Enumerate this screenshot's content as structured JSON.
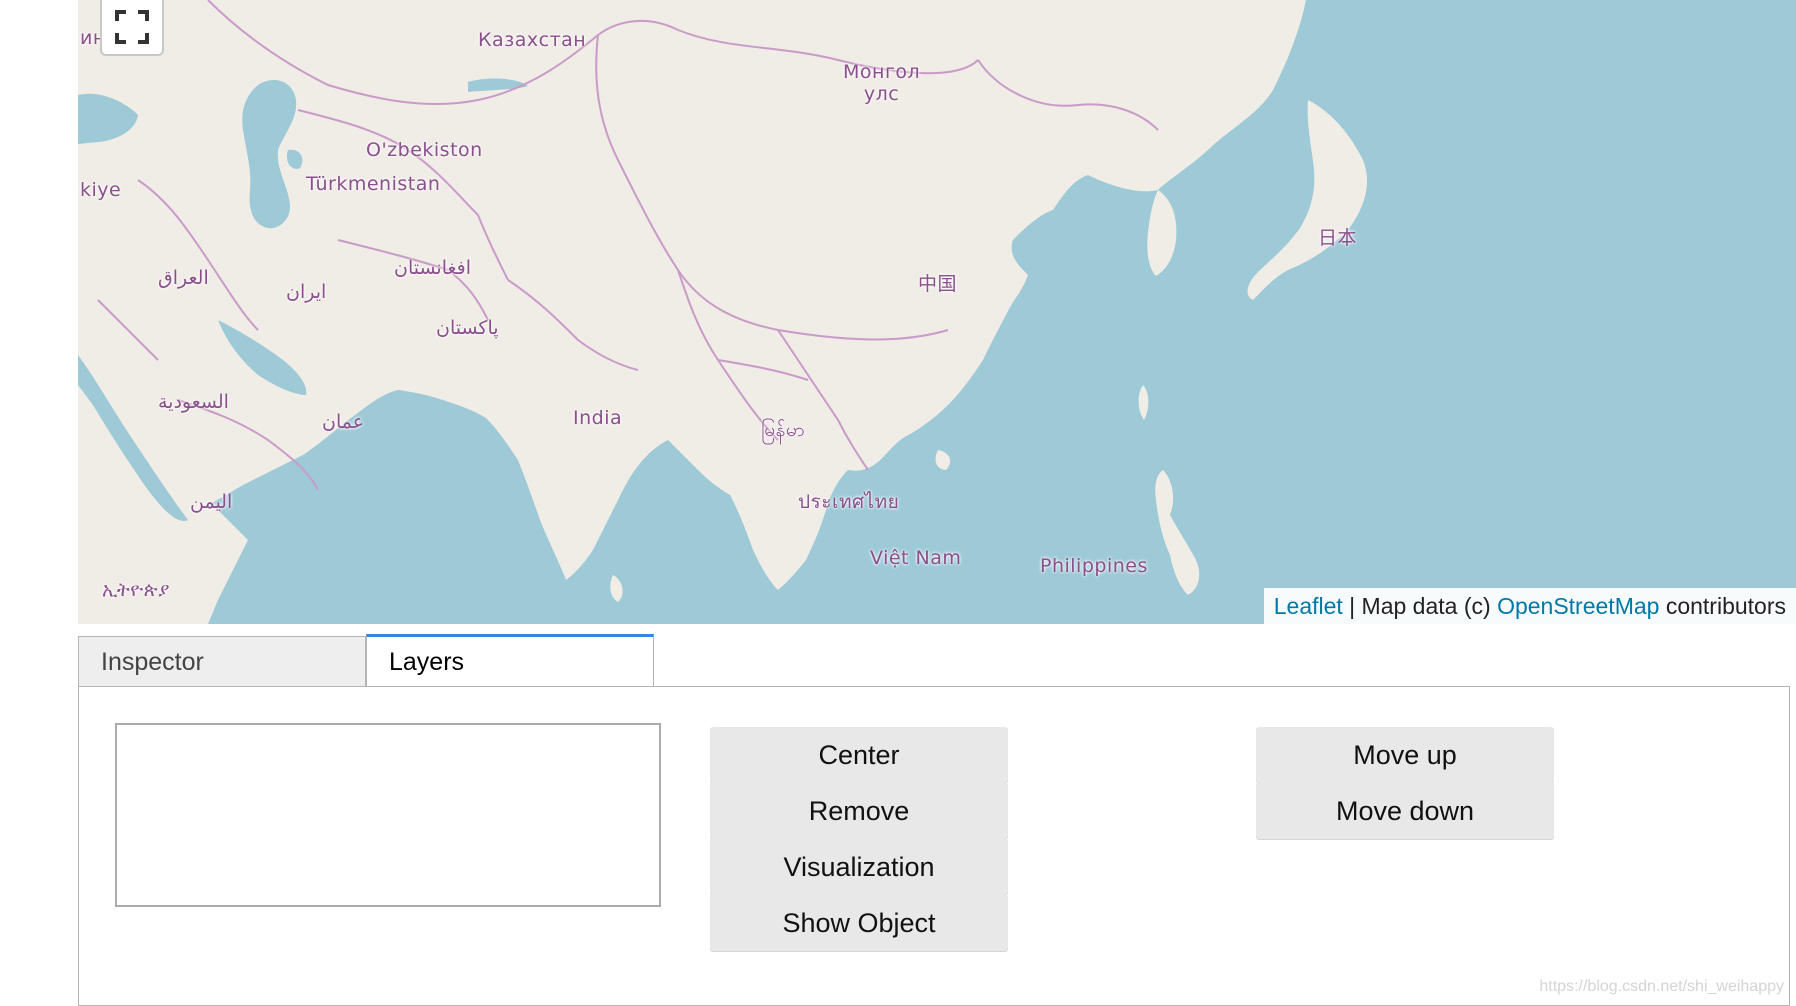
{
  "map": {
    "labels": [
      {
        "key": "kazakhstan",
        "text": "Казахстан"
      },
      {
        "key": "mongolia",
        "text": "Монгол\nулс"
      },
      {
        "key": "uzbekistan",
        "text": "O'zbekiston"
      },
      {
        "key": "turkmenistan",
        "text": "Türkmenistan"
      },
      {
        "key": "turkiye",
        "text": "kiye"
      },
      {
        "key": "ukraine",
        "text": "ина"
      },
      {
        "key": "iraq",
        "text": "العراق"
      },
      {
        "key": "iran",
        "text": "ایران"
      },
      {
        "key": "afghanistan",
        "text": "افغانستان"
      },
      {
        "key": "pakistan",
        "text": "پاکستان"
      },
      {
        "key": "china",
        "text": "中国"
      },
      {
        "key": "japan",
        "text": "日本"
      },
      {
        "key": "saudi",
        "text": "السعودية"
      },
      {
        "key": "oman",
        "text": "عمان"
      },
      {
        "key": "india",
        "text": "India"
      },
      {
        "key": "myanmar",
        "text": "မြန်မာ"
      },
      {
        "key": "thailand",
        "text": "ประเทศไทย"
      },
      {
        "key": "yemen",
        "text": "اليمن"
      },
      {
        "key": "vietnam",
        "text": "Việt Nam"
      },
      {
        "key": "philippines",
        "text": "Philippines"
      },
      {
        "key": "ethiopia",
        "text": "ኢትዮጵያ"
      }
    ],
    "attribution": {
      "leaflet": "Leaflet",
      "separator": " | Map data (c) ",
      "osm": "OpenStreetMap",
      "suffix": " contributors"
    },
    "fullscreen_icon": "fullscreen-icon"
  },
  "tabs": [
    {
      "label": "Inspector",
      "active": false
    },
    {
      "label": "Layers",
      "active": true
    }
  ],
  "panel": {
    "buttons": {
      "center": "Center",
      "remove": "Remove",
      "visualization": "Visualization",
      "show_object": "Show Object",
      "move_up": "Move up",
      "move_down": "Move down"
    }
  },
  "watermark": "https://blog.csdn.net/shi_weihappy",
  "colors": {
    "water": "#9ec9d7",
    "land": "#f0ece6",
    "border": "#c99bc8",
    "label": "#8a4f8c",
    "tab_active_accent": "#2f86eb",
    "link": "#0078a8"
  }
}
